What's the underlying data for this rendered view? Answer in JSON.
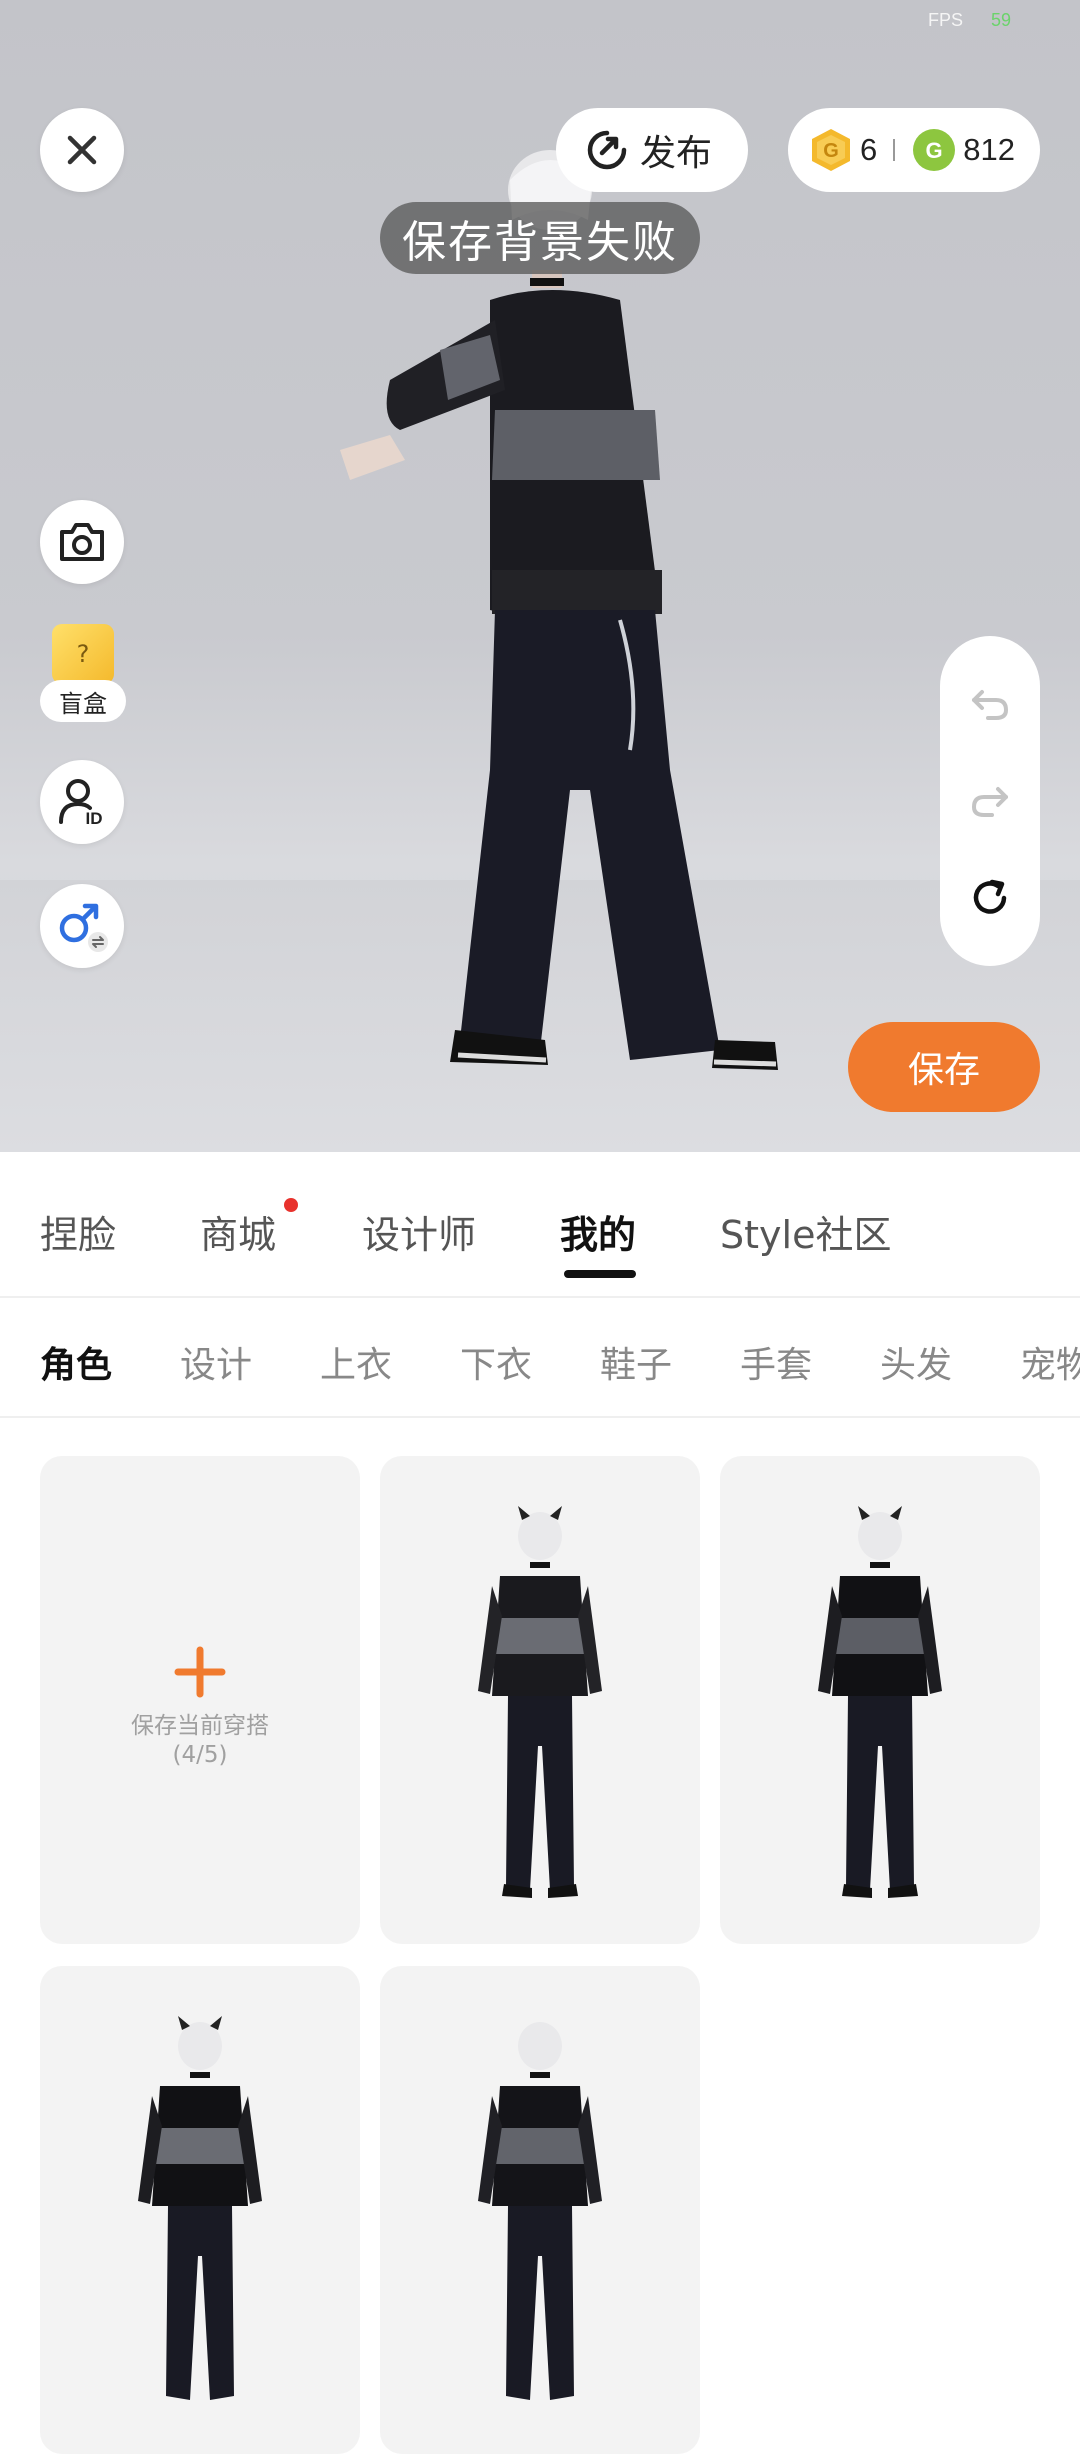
{
  "status": {
    "fps_label": "FPS",
    "fps_value": "59"
  },
  "header": {
    "publish_label": "发布",
    "gold_coins": "6",
    "green_coins": "812",
    "toast": "保存背景失败"
  },
  "side_tools": {
    "blind_box_label": "盲盒",
    "blind_box_glyph": "?"
  },
  "actions": {
    "save_label": "保存"
  },
  "main_tabs": [
    {
      "label": "捏脸"
    },
    {
      "label": "商城"
    },
    {
      "label": "设计师"
    },
    {
      "label": "我的"
    },
    {
      "label": "Style社区"
    }
  ],
  "sub_tabs": [
    {
      "label": "角色"
    },
    {
      "label": "设计"
    },
    {
      "label": "上衣"
    },
    {
      "label": "下衣"
    },
    {
      "label": "鞋子"
    },
    {
      "label": "手套"
    },
    {
      "label": "头发"
    },
    {
      "label": "宠物"
    }
  ],
  "outfits": {
    "add_label": "保存当前穿搭",
    "add_count": "(4/5)"
  },
  "colors": {
    "accent": "#f07a2e",
    "red_dot": "#e8322d",
    "gold_coin": "#f4b92c",
    "green_coin": "#8dc63f"
  }
}
